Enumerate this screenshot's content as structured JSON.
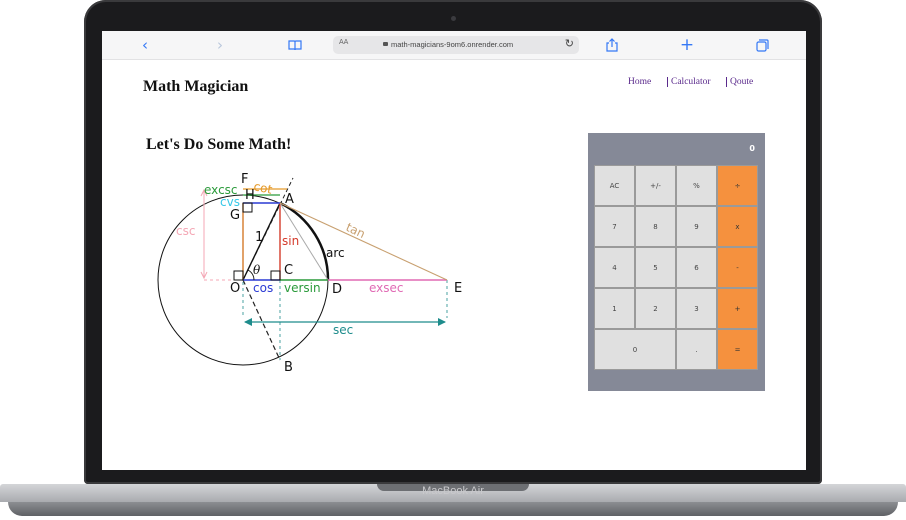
{
  "browser": {
    "url": "math-magicians-9om6.onrender.com",
    "text_size_label": "AA"
  },
  "site": {
    "brand": "Math Magician",
    "nav": [
      "Home",
      "Calculator",
      "Qoute"
    ]
  },
  "page": {
    "heading": "Let's Do Some Math!"
  },
  "diagram": {
    "labels": [
      "F",
      "A",
      "H",
      "G",
      "C",
      "O",
      "D",
      "E",
      "B",
      "1",
      "θ",
      "cot",
      "excsc",
      "cvs",
      "csc",
      "sin",
      "cos",
      "versin",
      "exsec",
      "arc",
      "tan",
      "sec"
    ]
  },
  "calculator": {
    "display": "0",
    "keys": [
      "AC",
      "+/-",
      "%",
      "÷",
      "7",
      "8",
      "9",
      "x",
      "4",
      "5",
      "6",
      "-",
      "1",
      "2",
      "3",
      "+",
      "0",
      ".",
      "="
    ],
    "operator_color": "#f5913e",
    "key_color": "#e0e0e0",
    "body_color": "#858997"
  },
  "device": {
    "model": "MacBook Air"
  },
  "icons": [
    "back-icon",
    "forward-icon",
    "bookmarks-icon",
    "lock-icon",
    "reload-icon",
    "share-icon",
    "new-tab-icon",
    "tabs-icon"
  ]
}
